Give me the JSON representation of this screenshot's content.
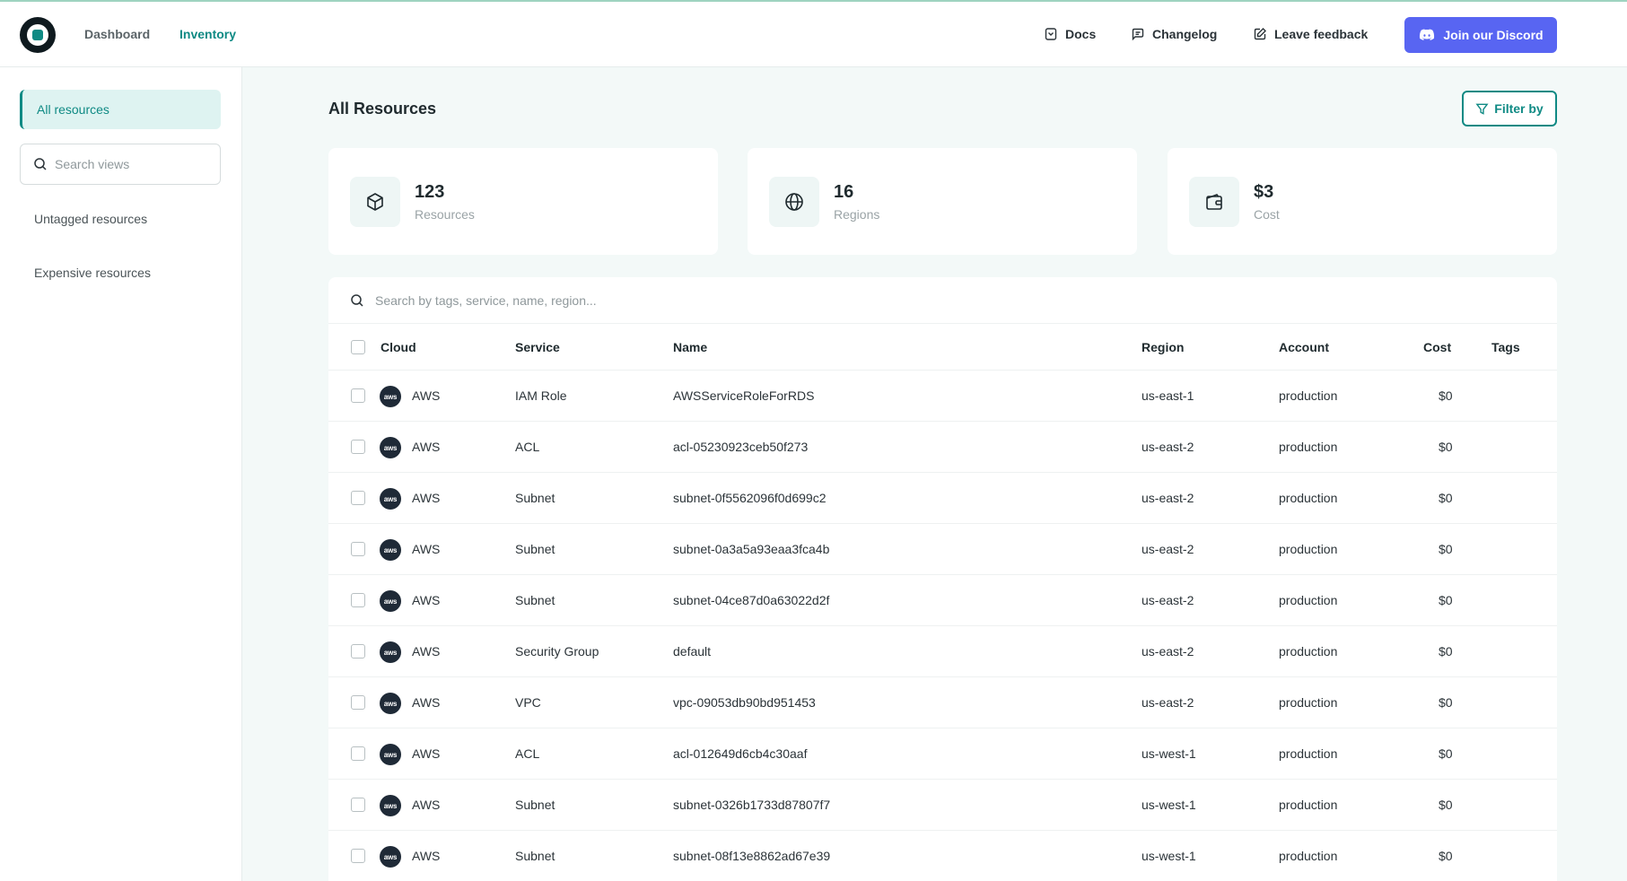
{
  "nav": {
    "links": [
      "Dashboard",
      "Inventory"
    ],
    "active": "Inventory",
    "docs": "Docs",
    "changelog": "Changelog",
    "feedback": "Leave feedback",
    "discord": "Join our Discord"
  },
  "sidebar": {
    "active_item": "All resources",
    "search_placeholder": "Search views",
    "items": [
      "Untagged resources",
      "Expensive resources"
    ]
  },
  "main": {
    "title": "All Resources",
    "filter_label": "Filter by",
    "stats": [
      {
        "value": "123",
        "label": "Resources",
        "icon": "cube-icon"
      },
      {
        "value": "16",
        "label": "Regions",
        "icon": "globe-icon"
      },
      {
        "value": "$3",
        "label": "Cost",
        "icon": "wallet-icon"
      }
    ],
    "table_search_placeholder": "Search by tags, service, name, region...",
    "columns": [
      "Cloud",
      "Service",
      "Name",
      "Region",
      "Account",
      "Cost",
      "Tags"
    ],
    "rows": [
      {
        "cloud": "AWS",
        "service": "IAM Role",
        "name": "AWSServiceRoleForRDS",
        "region": "us-east-1",
        "account": "production",
        "cost": "$0"
      },
      {
        "cloud": "AWS",
        "service": "ACL",
        "name": "acl-05230923ceb50f273",
        "region": "us-east-2",
        "account": "production",
        "cost": "$0"
      },
      {
        "cloud": "AWS",
        "service": "Subnet",
        "name": "subnet-0f5562096f0d699c2",
        "region": "us-east-2",
        "account": "production",
        "cost": "$0"
      },
      {
        "cloud": "AWS",
        "service": "Subnet",
        "name": "subnet-0a3a5a93eaa3fca4b",
        "region": "us-east-2",
        "account": "production",
        "cost": "$0"
      },
      {
        "cloud": "AWS",
        "service": "Subnet",
        "name": "subnet-04ce87d0a63022d2f",
        "region": "us-east-2",
        "account": "production",
        "cost": "$0"
      },
      {
        "cloud": "AWS",
        "service": "Security Group",
        "name": "default",
        "region": "us-east-2",
        "account": "production",
        "cost": "$0"
      },
      {
        "cloud": "AWS",
        "service": "VPC",
        "name": "vpc-09053db90bd951453",
        "region": "us-east-2",
        "account": "production",
        "cost": "$0"
      },
      {
        "cloud": "AWS",
        "service": "ACL",
        "name": "acl-012649d6cb4c30aaf",
        "region": "us-west-1",
        "account": "production",
        "cost": "$0"
      },
      {
        "cloud": "AWS",
        "service": "Subnet",
        "name": "subnet-0326b1733d87807f7",
        "region": "us-west-1",
        "account": "production",
        "cost": "$0"
      },
      {
        "cloud": "AWS",
        "service": "Subnet",
        "name": "subnet-08f13e8862ad67e39",
        "region": "us-west-1",
        "account": "production",
        "cost": "$0"
      }
    ]
  },
  "colors": {
    "accent": "#0f8a84",
    "discord": "#5865f2",
    "background": "#f3f9f8"
  }
}
